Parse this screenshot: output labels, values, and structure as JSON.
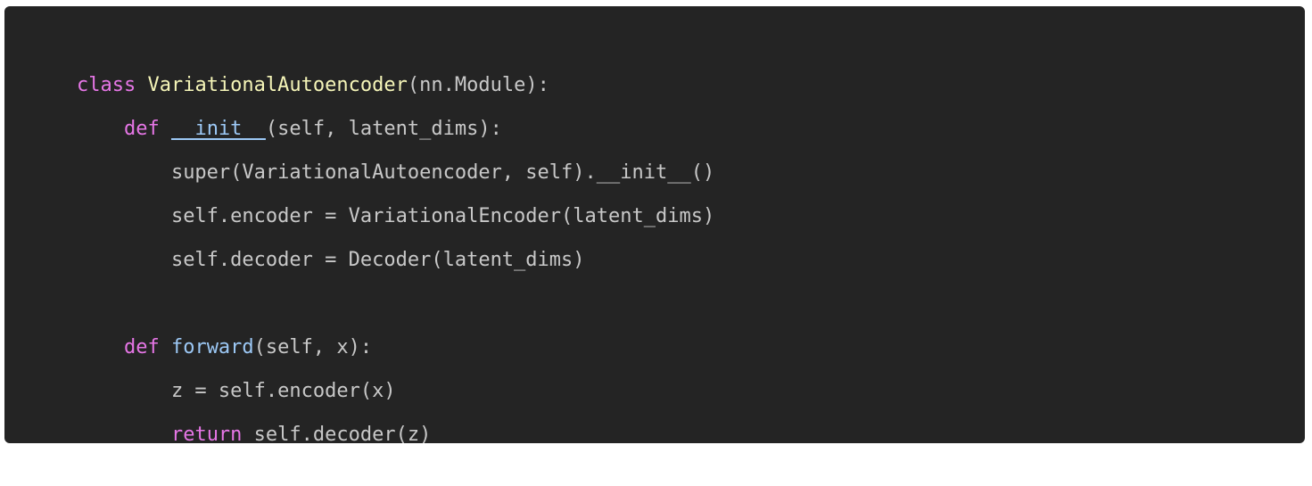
{
  "code": {
    "lines": [
      {
        "tokens": [
          {
            "text": "class ",
            "kind": "kw-class"
          },
          {
            "text": "VariationalAutoencoder",
            "kind": "cls-name"
          },
          {
            "text": "(nn.Module):",
            "kind": "plain"
          }
        ]
      },
      {
        "tokens": [
          {
            "text": "    ",
            "kind": "plain"
          },
          {
            "text": "def ",
            "kind": "kw-def"
          },
          {
            "text": "__init__",
            "kind": "fn-name"
          },
          {
            "text": "(self, latent_dims):",
            "kind": "plain"
          }
        ]
      },
      {
        "tokens": [
          {
            "text": "        super(VariationalAutoencoder, self).__init__()",
            "kind": "plain"
          }
        ]
      },
      {
        "tokens": [
          {
            "text": "        self.encoder = VariationalEncoder(latent_dims)",
            "kind": "plain"
          }
        ]
      },
      {
        "tokens": [
          {
            "text": "        self.decoder = Decoder(latent_dims)",
            "kind": "plain"
          }
        ]
      },
      {
        "tokens": [
          {
            "text": "",
            "kind": "plain"
          }
        ]
      },
      {
        "tokens": [
          {
            "text": "    ",
            "kind": "plain"
          },
          {
            "text": "def ",
            "kind": "kw-def"
          },
          {
            "text": "forward",
            "kind": "fn-name"
          },
          {
            "text": "(self, x):",
            "kind": "plain"
          }
        ]
      },
      {
        "tokens": [
          {
            "text": "        z = self.encoder(x)",
            "kind": "plain"
          }
        ]
      },
      {
        "tokens": [
          {
            "text": "        ",
            "kind": "plain"
          },
          {
            "text": "return",
            "kind": "kw-return"
          },
          {
            "text": " self.decoder(z)",
            "kind": "plain"
          }
        ]
      }
    ]
  },
  "colors": {
    "background": "#242424",
    "keyword": "#e676e6",
    "class_name": "#f5f5b8",
    "function_name": "#9cc8f5",
    "text": "#c8c8c8"
  }
}
